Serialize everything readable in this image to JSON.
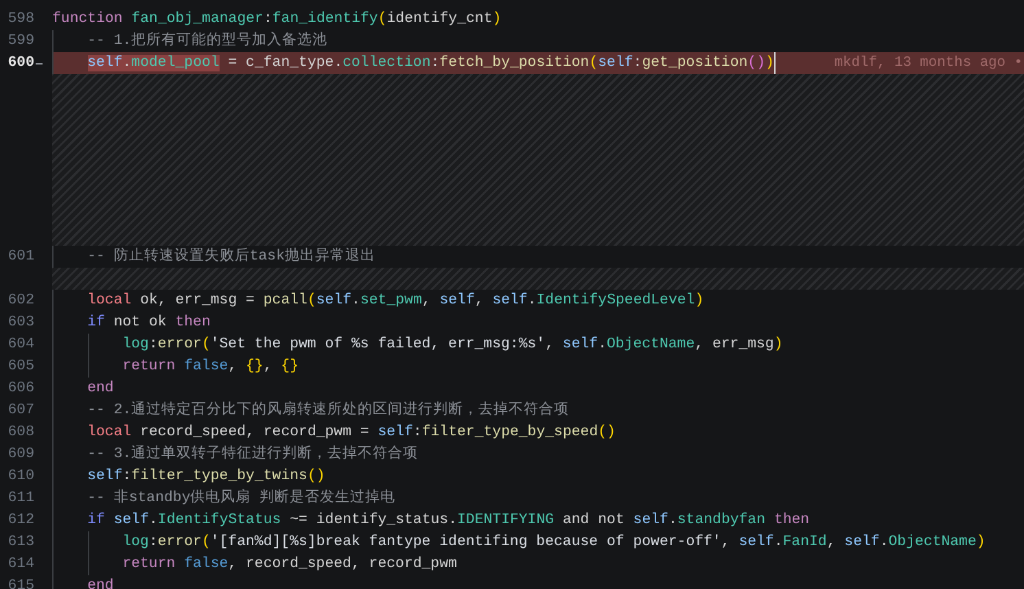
{
  "editor": {
    "lines": [
      {
        "kind": "code",
        "number": "598",
        "changed": false,
        "tokens": [
          {
            "kind": "kw",
            "text": "function "
          },
          {
            "kind": "fn",
            "text": "fan_obj_manager"
          },
          {
            "kind": "p",
            "text": ":"
          },
          {
            "kind": "fn",
            "text": "fan_identify"
          },
          {
            "kind": "b1",
            "text": "("
          },
          {
            "kind": "p",
            "text": "identify_cnt"
          },
          {
            "kind": "b1",
            "text": ")"
          }
        ],
        "children": [
          {
            "kind": "code",
            "number": "599",
            "changed": false,
            "tokens": [
              {
                "kind": "cm",
                "text": "-- 1.把所有可能的型号加入备选池"
              }
            ]
          },
          {
            "kind": "code",
            "number": "600",
            "changed": true,
            "cursor": true,
            "blame": "mkdlf, 13 months ago •",
            "tokens": [
              {
                "kind": "self",
                "text": "self",
                "highlighted": true
              },
              {
                "kind": "p",
                "text": ".",
                "highlighted": true
              },
              {
                "kind": "fn",
                "text": "model_pool",
                "highlighted": true
              },
              {
                "kind": "p",
                "text": " = c_fan_type."
              },
              {
                "kind": "fn",
                "text": "collection"
              },
              {
                "kind": "p",
                "text": ":"
              },
              {
                "kind": "call",
                "text": "fetch_by_position"
              },
              {
                "kind": "b1",
                "text": "("
              },
              {
                "kind": "self",
                "text": "self"
              },
              {
                "kind": "p",
                "text": ":"
              },
              {
                "kind": "call",
                "text": "get_position"
              },
              {
                "kind": "b2",
                "text": "()"
              },
              {
                "kind": "b1",
                "text": ")"
              }
            ]
          },
          {
            "kind": "filler"
          },
          {
            "kind": "code",
            "number": "601",
            "changed": false,
            "tokens": [
              {
                "kind": "cm",
                "text": "-- 防止转速设置失败后task抛出异常退出"
              }
            ]
          },
          {
            "kind": "strip"
          },
          {
            "kind": "code",
            "number": "602",
            "changed": false,
            "tokens": [
              {
                "kind": "local",
                "text": "local"
              },
              {
                "kind": "p",
                "text": " ok, err_msg = "
              },
              {
                "kind": "call",
                "text": "pcall"
              },
              {
                "kind": "b1",
                "text": "("
              },
              {
                "kind": "self",
                "text": "self"
              },
              {
                "kind": "p",
                "text": "."
              },
              {
                "kind": "fn",
                "text": "set_pwm"
              },
              {
                "kind": "p",
                "text": ", "
              },
              {
                "kind": "self",
                "text": "self"
              },
              {
                "kind": "p",
                "text": ", "
              },
              {
                "kind": "self",
                "text": "self"
              },
              {
                "kind": "p",
                "text": "."
              },
              {
                "kind": "fn",
                "text": "IdentifySpeedLevel"
              },
              {
                "kind": "b1",
                "text": ")"
              }
            ]
          },
          {
            "kind": "code",
            "number": "603",
            "changed": false,
            "tokens": [
              {
                "kind": "ctrl",
                "text": "if"
              },
              {
                "kind": "p",
                "text": " not ok "
              },
              {
                "kind": "kw",
                "text": "then"
              }
            ],
            "children": [
              {
                "kind": "code",
                "number": "604",
                "changed": false,
                "tokens": [
                  {
                    "kind": "fn",
                    "text": "log"
                  },
                  {
                    "kind": "p",
                    "text": ":"
                  },
                  {
                    "kind": "call",
                    "text": "error"
                  },
                  {
                    "kind": "b1",
                    "text": "("
                  },
                  {
                    "kind": "str",
                    "text": "'Set the pwm of %s failed, err_msg:%s'"
                  },
                  {
                    "kind": "p",
                    "text": ", "
                  },
                  {
                    "kind": "self",
                    "text": "self"
                  },
                  {
                    "kind": "p",
                    "text": "."
                  },
                  {
                    "kind": "fn",
                    "text": "ObjectName"
                  },
                  {
                    "kind": "p",
                    "text": ", err_msg"
                  },
                  {
                    "kind": "b1",
                    "text": ")"
                  }
                ]
              },
              {
                "kind": "code",
                "number": "605",
                "changed": false,
                "tokens": [
                  {
                    "kind": "kw",
                    "text": "return "
                  },
                  {
                    "kind": "const",
                    "text": "false"
                  },
                  {
                    "kind": "p",
                    "text": ", "
                  },
                  {
                    "kind": "b1",
                    "text": "{}"
                  },
                  {
                    "kind": "p",
                    "text": ", "
                  },
                  {
                    "kind": "b1",
                    "text": "{}"
                  }
                ]
              }
            ]
          },
          {
            "kind": "code",
            "number": "606",
            "changed": false,
            "tokens": [
              {
                "kind": "kw",
                "text": "end"
              }
            ]
          },
          {
            "kind": "code",
            "number": "607",
            "changed": false,
            "tokens": [
              {
                "kind": "cm",
                "text": "-- 2.通过特定百分比下的风扇转速所处的区间进行判断，去掉不符合项"
              }
            ]
          },
          {
            "kind": "code",
            "number": "608",
            "changed": false,
            "tokens": [
              {
                "kind": "local",
                "text": "local"
              },
              {
                "kind": "p",
                "text": " record_speed, record_pwm = "
              },
              {
                "kind": "self",
                "text": "self"
              },
              {
                "kind": "p",
                "text": ":"
              },
              {
                "kind": "call",
                "text": "filter_type_by_speed"
              },
              {
                "kind": "b1",
                "text": "()"
              }
            ]
          },
          {
            "kind": "code",
            "number": "609",
            "changed": false,
            "tokens": [
              {
                "kind": "cm",
                "text": "-- 3.通过单双转子特征进行判断，去掉不符合项"
              }
            ]
          },
          {
            "kind": "code",
            "number": "610",
            "changed": false,
            "tokens": [
              {
                "kind": "self",
                "text": "self"
              },
              {
                "kind": "p",
                "text": ":"
              },
              {
                "kind": "call",
                "text": "filter_type_by_twins"
              },
              {
                "kind": "b1",
                "text": "()"
              }
            ]
          },
          {
            "kind": "code",
            "number": "611",
            "changed": false,
            "tokens": [
              {
                "kind": "cm",
                "text": "-- 非standby供电风扇 判断是否发生过掉电"
              }
            ]
          },
          {
            "kind": "code",
            "number": "612",
            "changed": false,
            "tokens": [
              {
                "kind": "ctrl",
                "text": "if "
              },
              {
                "kind": "self",
                "text": "self"
              },
              {
                "kind": "p",
                "text": "."
              },
              {
                "kind": "fn",
                "text": "IdentifyStatus"
              },
              {
                "kind": "p",
                "text": " ~= identify_status."
              },
              {
                "kind": "fn",
                "text": "IDENTIFYING"
              },
              {
                "kind": "p",
                "text": " and not "
              },
              {
                "kind": "self",
                "text": "self"
              },
              {
                "kind": "p",
                "text": "."
              },
              {
                "kind": "fn",
                "text": "standbyfan "
              },
              {
                "kind": "kw",
                "text": "then"
              }
            ],
            "children": [
              {
                "kind": "code",
                "number": "613",
                "changed": false,
                "tokens": [
                  {
                    "kind": "fn",
                    "text": "log"
                  },
                  {
                    "kind": "p",
                    "text": ":"
                  },
                  {
                    "kind": "call",
                    "text": "error"
                  },
                  {
                    "kind": "b1",
                    "text": "("
                  },
                  {
                    "kind": "str",
                    "text": "'[fan%d][%s]break fantype identifing because of power-off'"
                  },
                  {
                    "kind": "p",
                    "text": ", "
                  },
                  {
                    "kind": "self",
                    "text": "self"
                  },
                  {
                    "kind": "p",
                    "text": "."
                  },
                  {
                    "kind": "fn",
                    "text": "FanId"
                  },
                  {
                    "kind": "p",
                    "text": ", "
                  },
                  {
                    "kind": "self",
                    "text": "self"
                  },
                  {
                    "kind": "p",
                    "text": "."
                  },
                  {
                    "kind": "fn",
                    "text": "ObjectName"
                  },
                  {
                    "kind": "b1",
                    "text": ")"
                  }
                ]
              },
              {
                "kind": "code",
                "number": "614",
                "changed": false,
                "tokens": [
                  {
                    "kind": "kw",
                    "text": "return "
                  },
                  {
                    "kind": "const",
                    "text": "false"
                  },
                  {
                    "kind": "p",
                    "text": ", record_speed, record_pwm"
                  }
                ]
              }
            ]
          },
          {
            "kind": "code",
            "number": "615",
            "changed": false,
            "tokens": [
              {
                "kind": "kw",
                "text": "end"
              }
            ]
          }
        ]
      }
    ]
  }
}
